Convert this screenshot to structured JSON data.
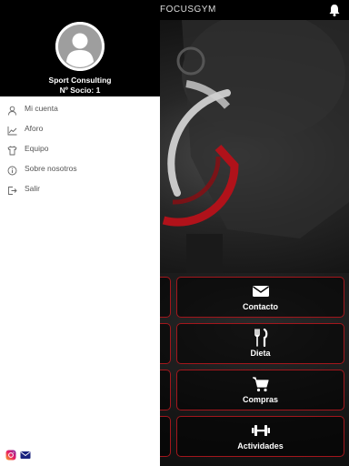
{
  "app": {
    "title": "FOCUSGYM"
  },
  "header": {
    "bell_icon": "bell-icon"
  },
  "drawer": {
    "user_name": "Sport Consulting",
    "member_number": "Nº Socio: 1",
    "items": [
      {
        "label": "Mi cuenta",
        "icon": "user-icon"
      },
      {
        "label": "Aforo",
        "icon": "chart-icon"
      },
      {
        "label": "Equipo",
        "icon": "shirt-icon"
      },
      {
        "label": "Sobre nosotros",
        "icon": "info-icon"
      },
      {
        "label": "Salir",
        "icon": "logout-icon"
      }
    ],
    "social": [
      {
        "icon": "instagram-icon"
      },
      {
        "icon": "mail-icon"
      }
    ]
  },
  "tiles": [
    {
      "label": "Contacto",
      "icon": "envelope-icon"
    },
    {
      "label": "Dieta",
      "icon": "cutlery-icon"
    },
    {
      "label": "Compras",
      "icon": "cart-icon"
    },
    {
      "label": "Actividades",
      "icon": "dumbbell-icon"
    }
  ],
  "colors": {
    "accent": "#a3161c",
    "drawer_bg": "#ffffff",
    "header_bg": "#000000"
  }
}
